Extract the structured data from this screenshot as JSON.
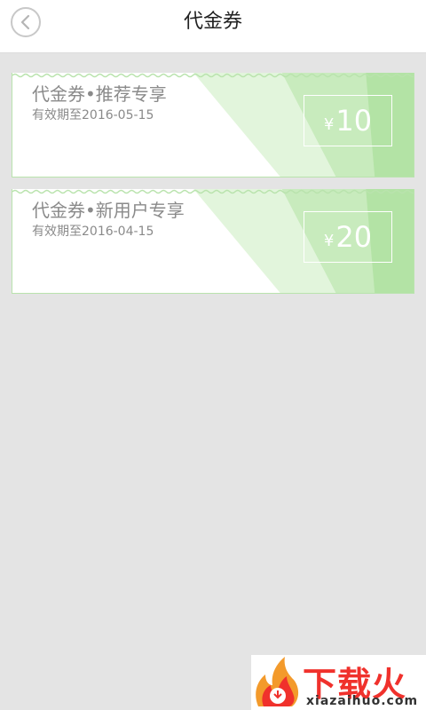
{
  "header": {
    "title": "代金券",
    "back_icon": "chevron-left-icon"
  },
  "coupons": [
    {
      "name": "代金券•推荐专享",
      "expiry": "有效期至2016-05-15",
      "currency": "¥",
      "amount": "10"
    },
    {
      "name": "代金券•新用户专享",
      "expiry": "有效期至2016-04-15",
      "currency": "¥",
      "amount": "20"
    }
  ],
  "colors": {
    "background": "#e4e4e4",
    "coupon_border": "#b9e3ad",
    "band_light": "#e2f5dc",
    "band_mid": "#c8ebbd",
    "band_dark": "#b3e3a5"
  },
  "watermark": {
    "brand": "下载火",
    "url": "xiazaihuo.com"
  }
}
